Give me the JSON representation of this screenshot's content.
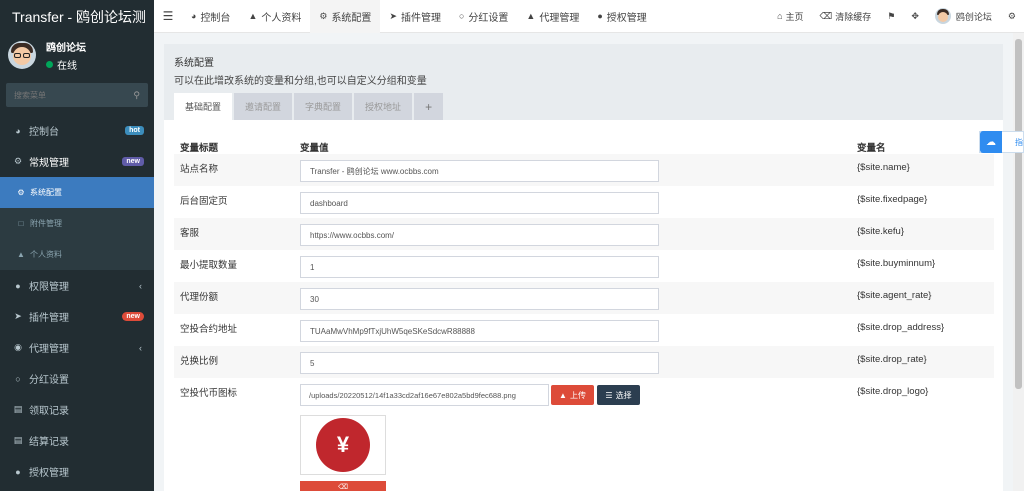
{
  "app": {
    "title": "Transfer - 鸥创论坛测"
  },
  "user": {
    "name": "鸥创论坛",
    "status": "在线"
  },
  "search": {
    "placeholder": "搜索菜单"
  },
  "sidebar": {
    "items": [
      {
        "label": "控制台",
        "icon": "dashboard-icon",
        "badge": "hot"
      },
      {
        "label": "常规管理",
        "icon": "cogs-icon",
        "badge": "new"
      },
      {
        "label": "系统配置",
        "icon": "gear-icon"
      },
      {
        "label": "附件管理",
        "icon": "file-icon"
      },
      {
        "label": "个人资料",
        "icon": "user-icon"
      },
      {
        "label": "权限管理",
        "icon": "group-icon",
        "arrow": "‹"
      },
      {
        "label": "插件管理",
        "icon": "rocket-icon",
        "badge": "new"
      },
      {
        "label": "代理管理",
        "icon": "user-circle-icon",
        "arrow": "‹"
      },
      {
        "label": "分红设置",
        "icon": "circle-icon"
      },
      {
        "label": "领取记录",
        "icon": "bank-icon"
      },
      {
        "label": "结算记录",
        "icon": "list-icon"
      },
      {
        "label": "授权管理",
        "icon": "group-icon"
      }
    ]
  },
  "topnav": {
    "tabs": [
      {
        "label": "控制台",
        "icon": "dashboard-icon"
      },
      {
        "label": "个人资料",
        "icon": "user-icon"
      },
      {
        "label": "系统配置",
        "icon": "gear-icon"
      },
      {
        "label": "插件管理",
        "icon": "rocket-icon"
      },
      {
        "label": "分红设置",
        "icon": "circle-icon"
      },
      {
        "label": "代理管理",
        "icon": "user-icon"
      },
      {
        "label": "授权管理",
        "icon": "group-icon"
      }
    ],
    "home": "主页",
    "clear_cache": "清除缓存",
    "username": "鸥创论坛"
  },
  "panel": {
    "title": "系统配置",
    "description": "可以在此增改系统的变量和分组,也可以自定义分组和变量",
    "tabs": [
      "基础配置",
      "邀请配置",
      "字典配置",
      "授权地址"
    ]
  },
  "table": {
    "headers": [
      "变量标题",
      "变量值",
      "变量名"
    ],
    "rows": [
      {
        "title": "站点名称",
        "value": "Transfer - 鸥创论坛 www.ocbbs.com",
        "name": "{$site.name}"
      },
      {
        "title": "后台固定页",
        "value": "dashboard",
        "name": "{$site.fixedpage}"
      },
      {
        "title": "客服",
        "value": "https://www.ocbbs.com/",
        "name": "{$site.kefu}"
      },
      {
        "title": "最小提取数量",
        "value": "1",
        "name": "{$site.buyminnum}"
      },
      {
        "title": "代理份额",
        "value": "30",
        "name": "{$site.agent_rate}"
      },
      {
        "title": "空投合约地址",
        "value": "TUAaMwVhMp9fTxjUhW5qeSKeSdcwR88888",
        "name": "{$site.drop_address}"
      },
      {
        "title": "兑换比例",
        "value": "5",
        "name": "{$site.drop_rate}"
      },
      {
        "title": "空投代币图标",
        "value": "/uploads/20220512/14f1a33cd2af16e67e802a5bd9fec688.png",
        "name": "{$site.drop_logo}"
      }
    ],
    "upload_label": "上传",
    "choose_label": "选择"
  },
  "widget": {
    "text": "指"
  }
}
